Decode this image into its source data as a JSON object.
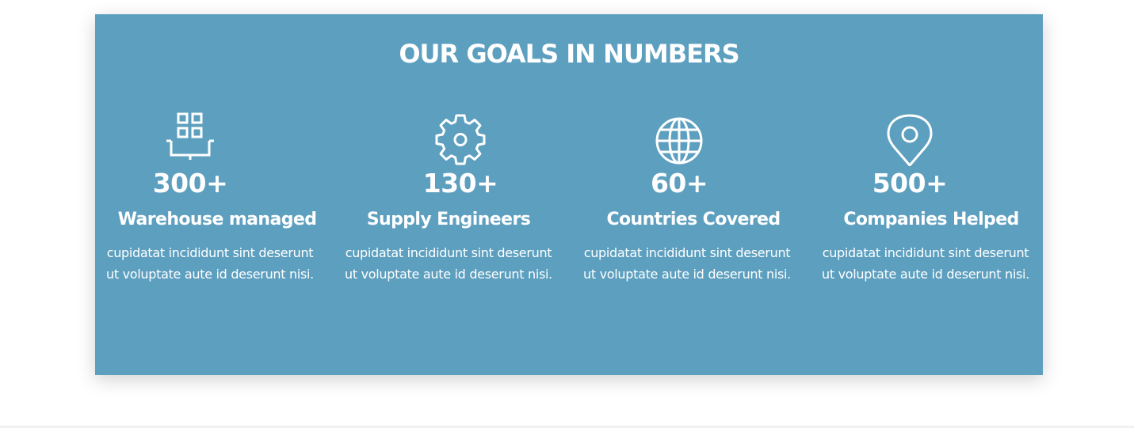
{
  "section": {
    "title": "OUR GOALS IN NUMBERS",
    "background_color": "#5d9fbf",
    "text_color": "#ffffff"
  },
  "stats": [
    {
      "icon": "warehouse-icon",
      "number": "300+",
      "label": "Warehouse managed",
      "description": "cupidatat incididunt sint deserunt ut voluptate aute id deserunt nisi."
    },
    {
      "icon": "gear-icon",
      "number": "130+",
      "label": "Supply Engineers",
      "description": "cupidatat incididunt sint deserunt ut voluptate aute id deserunt nisi."
    },
    {
      "icon": "globe-icon",
      "number": "60+",
      "label": "Countries Covered",
      "description": "cupidatat incididunt sint deserunt ut voluptate aute id deserunt nisi."
    },
    {
      "icon": "map-pin-icon",
      "number": "500+",
      "label": "Companies Helped",
      "description": "cupidatat incididunt sint deserunt ut voluptate aute id deserunt nisi."
    }
  ]
}
